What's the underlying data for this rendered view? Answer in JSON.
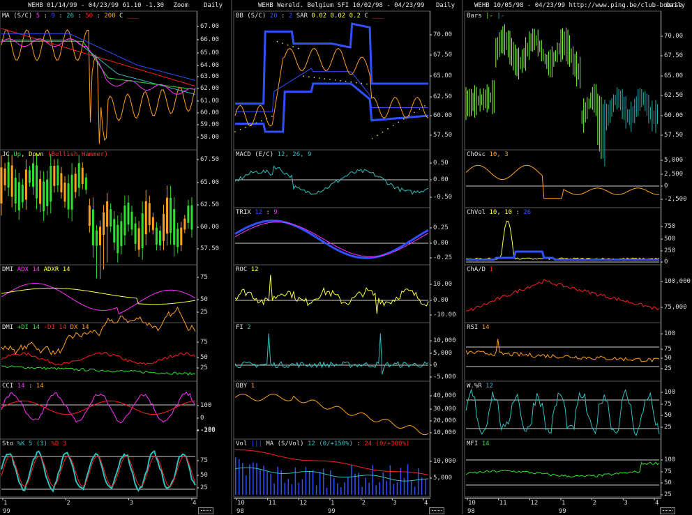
{
  "columns": [
    {
      "symbol": "WEHB",
      "info": "01/14/99 - 04/23/99   61.10  -1.30",
      "zoom": "Zoom",
      "period": "Daily"
    },
    {
      "symbol": "WEHB",
      "info": "Wereld. Belgium SFI  10/02/98 - 04/23/99",
      "zoom": "",
      "period": "Daily"
    },
    {
      "symbol": "WEHB",
      "info": "10/05/98 - 04/23/99   http://www.ping.be/club-bourse",
      "zoom": "",
      "period": "Daily"
    }
  ],
  "colors": {
    "bg": "#000000",
    "grid": "#5a5a5a",
    "axis": "#d8d8d8",
    "yellow": "#ffff40",
    "orange": "#ffa020",
    "red": "#ff2020",
    "green": "#30e030",
    "blue": "#3050ff",
    "cyan": "#30c0c0",
    "magenta": "#ff30ff",
    "lime": "#80ff40",
    "teal": "#20b0b0"
  },
  "panels": [
    {
      "id": "ma",
      "title_parts": [
        {
          "t": "MA (S/C)",
          "c": "#e0e0e0"
        },
        {
          "t": " 5",
          "c": "#ff30ff"
        },
        {
          "t": " : ",
          "c": "#e0e0e0"
        },
        {
          "t": "9",
          "c": "#3050ff"
        },
        {
          "t": " : ",
          "c": "#e0e0e0"
        },
        {
          "t": "26",
          "c": "#30c0c0"
        },
        {
          "t": " : ",
          "c": "#e0e0e0"
        },
        {
          "t": "50",
          "c": "#ff2020"
        },
        {
          "t": " : ",
          "c": "#e0e0e0"
        },
        {
          "t": "200",
          "c": "#ffa020"
        },
        {
          "t": "   C",
          "c": "#e0e0e0"
        },
        {
          "t": "  ___",
          "c": "#ff4040"
        }
      ],
      "ticks": [
        "67.00",
        "66.00",
        "65.00",
        "64.00",
        "63.00",
        "62.00",
        "61.00",
        "60.00",
        "59.00",
        "58.00"
      ]
    },
    {
      "id": "jc",
      "title_parts": [
        {
          "t": "JC ",
          "c": "#e0e0e0"
        },
        {
          "t": "Up",
          "c": "#30e030"
        },
        {
          "t": ", Down ",
          "c": "#ffff40"
        },
        {
          "t": "(Bullish Hammer)",
          "c": "#ff3030"
        }
      ],
      "ticks": [
        "67.50",
        "65.00",
        "62.50",
        "60.00",
        "57.50"
      ]
    },
    {
      "id": "dmi",
      "title_parts": [
        {
          "t": "DMI ",
          "c": "#e0e0e0"
        },
        {
          "t": "ADX 14",
          "c": "#ff30ff"
        },
        {
          "t": "  ",
          "c": "#e0e0e0"
        },
        {
          "t": "ADXR 14",
          "c": "#ffff40"
        }
      ],
      "ticks": [
        "75",
        "50",
        "25"
      ]
    },
    {
      "id": "dmi2",
      "title_parts": [
        {
          "t": "DMI ",
          "c": "#e0e0e0"
        },
        {
          "t": "+DI 14",
          "c": "#30e030"
        },
        {
          "t": "  ",
          "c": "#e0e0e0"
        },
        {
          "t": "-DI 14",
          "c": "#ff2020"
        },
        {
          "t": "  ",
          "c": "#e0e0e0"
        },
        {
          "t": "DX 14",
          "c": "#ffa020"
        }
      ],
      "ticks": [
        "75",
        "50",
        "25"
      ]
    },
    {
      "id": "cci",
      "title_parts": [
        {
          "t": "CCI ",
          "c": "#e0e0e0"
        },
        {
          "t": "14",
          "c": "#ff30ff"
        },
        {
          "t": " : ",
          "c": "#e0e0e0"
        },
        {
          "t": "14",
          "c": "#ffa020"
        }
      ],
      "ticks": [
        "100",
        "0",
        "-100",
        "-200"
      ]
    },
    {
      "id": "sto",
      "title_parts": [
        {
          "t": "Sto ",
          "c": "#e0e0e0"
        },
        {
          "t": "%K 5 (3)",
          "c": "#30c0c0"
        },
        {
          "t": "  ",
          "c": "#e0e0e0"
        },
        {
          "t": "%D 3",
          "c": "#ff2020"
        }
      ],
      "ticks": [
        "75",
        "50",
        "25"
      ]
    },
    {
      "id": "bb",
      "title_parts": [
        {
          "t": "BB (S/C)",
          "c": "#e0e0e0"
        },
        {
          "t": " 20",
          "c": "#3050ff"
        },
        {
          "t": " : ",
          "c": "#e0e0e0"
        },
        {
          "t": "2",
          "c": "#3050ff"
        },
        {
          "t": "    SAR ",
          "c": "#e0e0e0"
        },
        {
          "t": " 0.02",
          "c": "#ffff40"
        },
        {
          "t": "  0.02",
          "c": "#ffff40"
        },
        {
          "t": "  0.2",
          "c": "#ffff40"
        },
        {
          "t": "    C",
          "c": "#e0e0e0"
        },
        {
          "t": "  ___",
          "c": "#ff4040"
        }
      ],
      "ticks": [
        "70.00",
        "67.50",
        "65.00",
        "62.50",
        "60.00",
        "57.50"
      ]
    },
    {
      "id": "macd",
      "title_parts": [
        {
          "t": "MACD (E/C)",
          "c": "#e0e0e0"
        },
        {
          "t": " 12, 26, 9",
          "c": "#30c0c0"
        }
      ],
      "ticks": [
        "0.50",
        "0.00",
        "-0.50"
      ]
    },
    {
      "id": "trix",
      "title_parts": [
        {
          "t": "TRIX ",
          "c": "#e0e0e0"
        },
        {
          "t": "12",
          "c": "#3050ff"
        },
        {
          "t": " : ",
          "c": "#e0e0e0"
        },
        {
          "t": "9",
          "c": "#ff30ff"
        }
      ],
      "ticks": [
        "0.25",
        "0.00",
        "-0.25"
      ]
    },
    {
      "id": "roc",
      "title_parts": [
        {
          "t": "ROC ",
          "c": "#e0e0e0"
        },
        {
          "t": "12",
          "c": "#ffff40"
        }
      ],
      "ticks": [
        "10.00",
        "0.00",
        "-10.00"
      ]
    },
    {
      "id": "fi",
      "title_parts": [
        {
          "t": "FI ",
          "c": "#e0e0e0"
        },
        {
          "t": "2",
          "c": "#30c0c0"
        }
      ],
      "ticks": [
        "10,000",
        "5,000",
        "0",
        "-5,000"
      ]
    },
    {
      "id": "oby",
      "title_parts": [
        {
          "t": "OBY ",
          "c": "#e0e0e0"
        },
        {
          "t": "1",
          "c": "#ffa020"
        }
      ],
      "ticks": [
        "40,000",
        "30,000",
        "20,000",
        "10,000"
      ]
    },
    {
      "id": "vol",
      "title_parts": [
        {
          "t": "Vol ",
          "c": "#e0e0e0"
        },
        {
          "t": "|||",
          "c": "#3050ff"
        },
        {
          "t": "   MA (S/Vol) ",
          "c": "#e0e0e0"
        },
        {
          "t": "12 (0/+150%)",
          "c": "#30c0c0"
        },
        {
          "t": " : ",
          "c": "#e0e0e0"
        },
        {
          "t": "24 (0/+300%)",
          "c": "#ff2020"
        }
      ],
      "ticks": [
        "10,000",
        "5,000"
      ]
    },
    {
      "id": "bars",
      "title_parts": [
        {
          "t": "Bars ",
          "c": "#e0e0e0"
        },
        {
          "t": "|- ",
          "c": "#80ff40"
        },
        {
          "t": "|-",
          "c": "#30c0c0"
        }
      ],
      "ticks": [
        "70.00",
        "67.50",
        "65.00",
        "62.50",
        "60.00",
        "57.50"
      ]
    },
    {
      "id": "chosc",
      "title_parts": [
        {
          "t": "ChOsc ",
          "c": "#e0e0e0"
        },
        {
          "t": "10, 3",
          "c": "#ffa020"
        }
      ],
      "ticks": [
        "5,000",
        "2,500",
        "0",
        "-2,500"
      ]
    },
    {
      "id": "chvol",
      "title_parts": [
        {
          "t": "ChVol ",
          "c": "#e0e0e0"
        },
        {
          "t": "10, 10",
          "c": "#ffff40"
        },
        {
          "t": " : ",
          "c": "#e0e0e0"
        },
        {
          "t": "26",
          "c": "#3050ff"
        }
      ],
      "ticks": [
        "750",
        "500",
        "250",
        "0"
      ]
    },
    {
      "id": "chad",
      "title_parts": [
        {
          "t": "ChA/D ",
          "c": "#e0e0e0"
        },
        {
          "t": "1",
          "c": "#ff2020"
        }
      ],
      "ticks": [
        "100,000",
        "75,000"
      ]
    },
    {
      "id": "rsi",
      "title_parts": [
        {
          "t": "RSI ",
          "c": "#e0e0e0"
        },
        {
          "t": "14",
          "c": "#ffa020"
        }
      ],
      "ticks": [
        "100",
        "75",
        "50",
        "25"
      ]
    },
    {
      "id": "wr",
      "title_parts": [
        {
          "t": "W.%R ",
          "c": "#e0e0e0"
        },
        {
          "t": "12",
          "c": "#30c0c0"
        }
      ],
      "ticks": [
        "100",
        "75",
        "50",
        "25"
      ]
    },
    {
      "id": "mfi",
      "title_parts": [
        {
          "t": "MFI ",
          "c": "#e0e0e0"
        },
        {
          "t": "14",
          "c": "#30e030"
        }
      ],
      "ticks": [
        "100",
        "75",
        "50",
        "25"
      ]
    }
  ],
  "xaxes": [
    {
      "labels": [
        "1",
        "2",
        "3",
        "4"
      ],
      "year": "99"
    },
    {
      "labels": [
        "10",
        "11",
        "12",
        "1",
        "2",
        "3",
        "4"
      ],
      "years": [
        "98",
        "99"
      ]
    },
    {
      "labels": [
        "10",
        "11",
        "12",
        "1",
        "2",
        "3",
        "4"
      ],
      "years": [
        "98",
        "99"
      ]
    }
  ]
}
